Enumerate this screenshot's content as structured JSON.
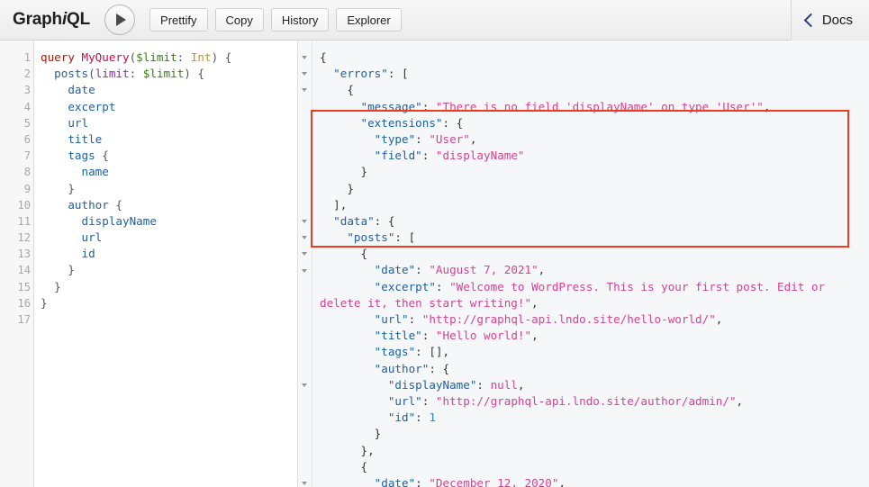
{
  "app": {
    "title": "GraphiQL",
    "title_prefix": "Graph",
    "title_italic": "i",
    "title_suffix": "QL"
  },
  "toolbar": {
    "execute_label": "▶",
    "execute_title": "Execute Query",
    "buttons": [
      {
        "label": "Prettify",
        "name": "prettify-button"
      },
      {
        "label": "Copy",
        "name": "copy-button"
      },
      {
        "label": "History",
        "name": "history-button"
      },
      {
        "label": "Explorer",
        "name": "explorer-button"
      }
    ],
    "docs_label": "Docs",
    "docs_icon": "chevron-left-icon"
  },
  "query_editor": {
    "gutter_lines": [
      "1",
      "2",
      "3",
      "4",
      "5",
      "6",
      "7",
      "8",
      "9",
      "10",
      "11",
      "12",
      "13",
      "14",
      "15",
      "16",
      "17"
    ],
    "fold_lines": [
      1,
      2,
      10
    ],
    "text": "query MyQuery($limit: Int) {\n  posts(limit: $limit) {\n    date\n    excerpt\n    url\n    title\n    tags {\n      name\n    }\n    author {\n      displayName\n      url\n      id\n    }\n  }\n}\n",
    "lines": [
      {
        "n": "1",
        "tokens": [
          {
            "t": "query ",
            "c": "t-kw"
          },
          {
            "t": "MyQuery",
            "c": "t-def"
          },
          {
            "t": "(",
            "c": "t-punct"
          },
          {
            "t": "$limit",
            "c": "t-var"
          },
          {
            "t": ": ",
            "c": "t-punct"
          },
          {
            "t": "Int",
            "c": "t-type"
          },
          {
            "t": ") {",
            "c": "t-punct"
          }
        ]
      },
      {
        "n": "2",
        "tokens": [
          {
            "t": "  ",
            "c": "t-p"
          },
          {
            "t": "posts",
            "c": "t-field"
          },
          {
            "t": "(",
            "c": "t-punct"
          },
          {
            "t": "limit",
            "c": "t-attr"
          },
          {
            "t": ": ",
            "c": "t-punct"
          },
          {
            "t": "$limit",
            "c": "t-var"
          },
          {
            "t": ") {",
            "c": "t-punct"
          }
        ]
      },
      {
        "n": "3",
        "tokens": [
          {
            "t": "    ",
            "c": "t-p"
          },
          {
            "t": "date",
            "c": "t-field"
          }
        ]
      },
      {
        "n": "4",
        "tokens": [
          {
            "t": "    ",
            "c": "t-p"
          },
          {
            "t": "excerpt",
            "c": "t-field"
          }
        ]
      },
      {
        "n": "5",
        "tokens": [
          {
            "t": "    ",
            "c": "t-p"
          },
          {
            "t": "url",
            "c": "t-field"
          }
        ]
      },
      {
        "n": "6",
        "tokens": [
          {
            "t": "    ",
            "c": "t-p"
          },
          {
            "t": "title",
            "c": "t-field"
          }
        ]
      },
      {
        "n": "7",
        "tokens": [
          {
            "t": "    ",
            "c": "t-p"
          },
          {
            "t": "tags",
            "c": "t-field"
          },
          {
            "t": " {",
            "c": "t-punct"
          }
        ]
      },
      {
        "n": "8",
        "tokens": [
          {
            "t": "      ",
            "c": "t-p"
          },
          {
            "t": "name",
            "c": "t-field"
          }
        ]
      },
      {
        "n": "9",
        "tokens": [
          {
            "t": "    }",
            "c": "t-brace"
          }
        ]
      },
      {
        "n": "10",
        "tokens": [
          {
            "t": "    ",
            "c": "t-p"
          },
          {
            "t": "author",
            "c": "t-field"
          },
          {
            "t": " {",
            "c": "t-punct"
          }
        ]
      },
      {
        "n": "11",
        "tokens": [
          {
            "t": "      ",
            "c": "t-p"
          },
          {
            "t": "displayName",
            "c": "t-field"
          }
        ]
      },
      {
        "n": "12",
        "tokens": [
          {
            "t": "      ",
            "c": "t-p"
          },
          {
            "t": "url",
            "c": "t-field"
          }
        ]
      },
      {
        "n": "13",
        "tokens": [
          {
            "t": "      ",
            "c": "t-p"
          },
          {
            "t": "id",
            "c": "t-field"
          }
        ]
      },
      {
        "n": "14",
        "tokens": [
          {
            "t": "    }",
            "c": "t-brace"
          }
        ]
      },
      {
        "n": "15",
        "tokens": [
          {
            "t": "  }",
            "c": "t-brace"
          }
        ]
      },
      {
        "n": "16",
        "tokens": [
          {
            "t": "}",
            "c": "t-brace"
          }
        ]
      },
      {
        "n": "17",
        "tokens": [
          {
            "t": "",
            "c": "t-p"
          }
        ]
      }
    ]
  },
  "result_panel": {
    "fold_rows": [
      0,
      1,
      2,
      10,
      11,
      12,
      13,
      19,
      25
    ],
    "lines": [
      {
        "tokens": [
          {
            "t": "{",
            "c": "j-p"
          }
        ]
      },
      {
        "tokens": [
          {
            "t": "  ",
            "c": "j-p"
          },
          {
            "t": "\"errors\"",
            "c": "j-key"
          },
          {
            "t": ": [",
            "c": "j-p"
          }
        ]
      },
      {
        "tokens": [
          {
            "t": "    {",
            "c": "j-p"
          }
        ]
      },
      {
        "tokens": [
          {
            "t": "      ",
            "c": "j-p"
          },
          {
            "t": "\"message\"",
            "c": "j-key"
          },
          {
            "t": ": ",
            "c": "j-p"
          },
          {
            "t": "\"There is no field 'displayName' on type 'User'\"",
            "c": "j-str"
          },
          {
            "t": ",",
            "c": "j-p"
          }
        ]
      },
      {
        "tokens": [
          {
            "t": "      ",
            "c": "j-p"
          },
          {
            "t": "\"extensions\"",
            "c": "j-key"
          },
          {
            "t": ": {",
            "c": "j-p"
          }
        ]
      },
      {
        "tokens": [
          {
            "t": "        ",
            "c": "j-p"
          },
          {
            "t": "\"type\"",
            "c": "j-key"
          },
          {
            "t": ": ",
            "c": "j-p"
          },
          {
            "t": "\"User\"",
            "c": "j-str"
          },
          {
            "t": ",",
            "c": "j-p"
          }
        ]
      },
      {
        "tokens": [
          {
            "t": "        ",
            "c": "j-p"
          },
          {
            "t": "\"field\"",
            "c": "j-key"
          },
          {
            "t": ": ",
            "c": "j-p"
          },
          {
            "t": "\"displayName\"",
            "c": "j-str"
          }
        ]
      },
      {
        "tokens": [
          {
            "t": "      }",
            "c": "j-p"
          }
        ]
      },
      {
        "tokens": [
          {
            "t": "    }",
            "c": "j-p"
          }
        ]
      },
      {
        "tokens": [
          {
            "t": "  ],",
            "c": "j-p"
          }
        ]
      },
      {
        "tokens": [
          {
            "t": "  ",
            "c": "j-p"
          },
          {
            "t": "\"data\"",
            "c": "j-key"
          },
          {
            "t": ": {",
            "c": "j-p"
          }
        ]
      },
      {
        "tokens": [
          {
            "t": "    ",
            "c": "j-p"
          },
          {
            "t": "\"posts\"",
            "c": "j-key"
          },
          {
            "t": ": [",
            "c": "j-p"
          }
        ]
      },
      {
        "tokens": [
          {
            "t": "      {",
            "c": "j-p"
          }
        ]
      },
      {
        "tokens": [
          {
            "t": "        ",
            "c": "j-p"
          },
          {
            "t": "\"date\"",
            "c": "j-key"
          },
          {
            "t": ": ",
            "c": "j-p"
          },
          {
            "t": "\"August 7, 2021\"",
            "c": "j-str"
          },
          {
            "t": ",",
            "c": "j-p"
          }
        ]
      },
      {
        "wrap": true,
        "tokens": [
          {
            "t": "        ",
            "c": "j-p"
          },
          {
            "t": "\"excerpt\"",
            "c": "j-key"
          },
          {
            "t": ": ",
            "c": "j-p"
          },
          {
            "t": "\"Welcome to WordPress. This is your first post. Edit or delete it, then start writing!\"",
            "c": "j-str"
          },
          {
            "t": ",",
            "c": "j-p"
          }
        ]
      },
      {
        "tokens": [
          {
            "t": "        ",
            "c": "j-p"
          },
          {
            "t": "\"url\"",
            "c": "j-key"
          },
          {
            "t": ": ",
            "c": "j-p"
          },
          {
            "t": "\"http://graphql-api.lndo.site/hello-world/\"",
            "c": "j-str"
          },
          {
            "t": ",",
            "c": "j-p"
          }
        ]
      },
      {
        "tokens": [
          {
            "t": "        ",
            "c": "j-p"
          },
          {
            "t": "\"title\"",
            "c": "j-key"
          },
          {
            "t": ": ",
            "c": "j-p"
          },
          {
            "t": "\"Hello world!\"",
            "c": "j-str"
          },
          {
            "t": ",",
            "c": "j-p"
          }
        ]
      },
      {
        "tokens": [
          {
            "t": "        ",
            "c": "j-p"
          },
          {
            "t": "\"tags\"",
            "c": "j-key"
          },
          {
            "t": ": [],",
            "c": "j-p"
          }
        ]
      },
      {
        "tokens": [
          {
            "t": "        ",
            "c": "j-p"
          },
          {
            "t": "\"author\"",
            "c": "j-key"
          },
          {
            "t": ": {",
            "c": "j-p"
          }
        ]
      },
      {
        "tokens": [
          {
            "t": "          ",
            "c": "j-p"
          },
          {
            "t": "\"displayName\"",
            "c": "j-key"
          },
          {
            "t": ": ",
            "c": "j-p"
          },
          {
            "t": "null",
            "c": "j-null"
          },
          {
            "t": ",",
            "c": "j-p"
          }
        ]
      },
      {
        "tokens": [
          {
            "t": "          ",
            "c": "j-p"
          },
          {
            "t": "\"url\"",
            "c": "j-key"
          },
          {
            "t": ": ",
            "c": "j-p"
          },
          {
            "t": "\"http://graphql-api.lndo.site/author/admin/\"",
            "c": "j-str"
          },
          {
            "t": ",",
            "c": "j-p"
          }
        ]
      },
      {
        "tokens": [
          {
            "t": "          ",
            "c": "j-p"
          },
          {
            "t": "\"id\"",
            "c": "j-key"
          },
          {
            "t": ": ",
            "c": "j-p"
          },
          {
            "t": "1",
            "c": "j-num"
          }
        ]
      },
      {
        "tokens": [
          {
            "t": "        }",
            "c": "j-p"
          }
        ]
      },
      {
        "tokens": [
          {
            "t": "      },",
            "c": "j-p"
          }
        ]
      },
      {
        "tokens": [
          {
            "t": "      {",
            "c": "j-p"
          }
        ]
      },
      {
        "tokens": [
          {
            "t": "        ",
            "c": "j-p"
          },
          {
            "t": "\"date\"",
            "c": "j-key"
          },
          {
            "t": ": ",
            "c": "j-p"
          },
          {
            "t": "\"December 12, 2020\"",
            "c": "j-str"
          },
          {
            "t": ",",
            "c": "j-p"
          }
        ]
      }
    ]
  },
  "annotation": {
    "type": "red-rectangle-highlight",
    "color": "#ef3b21",
    "covers": "errors block"
  }
}
